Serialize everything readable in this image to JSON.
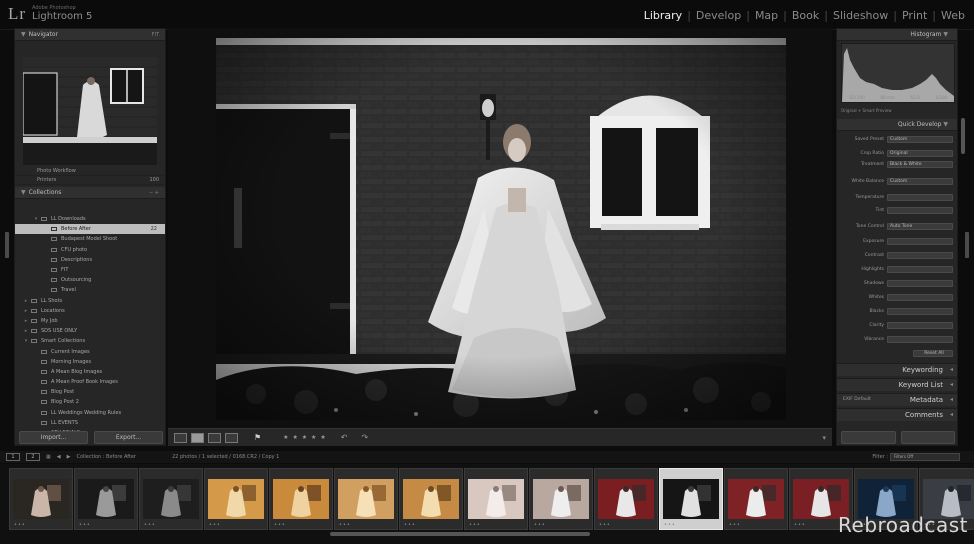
{
  "app": {
    "logo": "Lr",
    "brand_sub": "Adobe Photoshop",
    "brand_name": "Lightroom 5"
  },
  "modules": [
    "Library",
    "Develop",
    "Map",
    "Book",
    "Slideshow",
    "Print",
    "Web"
  ],
  "active_module": "Library",
  "left_panel": {
    "navigator_title": "Navigator",
    "navigator_zoom": "FIT",
    "folders": [
      {
        "name": "Photo Workflow",
        "count": ""
      },
      {
        "name": "Printers",
        "count": "100"
      }
    ],
    "collections_title": "Collections",
    "collections": [
      {
        "name": "LL Downloads",
        "count": "",
        "selected": false
      },
      {
        "name": "Before After",
        "count": "22",
        "selected": true
      },
      {
        "name": "Budapest Model Shoot",
        "count": "",
        "selected": false
      },
      {
        "name": "CFU photo",
        "count": "",
        "selected": false
      },
      {
        "name": "Descriptions",
        "count": "",
        "selected": false
      },
      {
        "name": "FIT",
        "count": "",
        "selected": false
      },
      {
        "name": "Outsourcing",
        "count": "",
        "selected": false
      },
      {
        "name": "Travel",
        "count": "",
        "selected": false
      },
      {
        "name": "LL Shots",
        "count": "",
        "selected": false
      },
      {
        "name": "Locations",
        "count": "",
        "selected": false
      },
      {
        "name": "My Job",
        "count": "",
        "selected": false
      },
      {
        "name": "SDS USE ONLY",
        "count": "",
        "selected": false
      },
      {
        "name": "Smart Collections",
        "count": "",
        "selected": false
      },
      {
        "name": "Current Images",
        "count": "",
        "selected": false
      },
      {
        "name": "Morning Images",
        "count": "",
        "selected": false
      },
      {
        "name": "A Mean Blog Images",
        "count": "",
        "selected": false
      },
      {
        "name": "A Mean Proof Book Images",
        "count": "",
        "selected": false
      },
      {
        "name": "Blog Post",
        "count": "",
        "selected": false
      },
      {
        "name": "Blog Post 2",
        "count": "",
        "selected": false
      },
      {
        "name": "LL Weddings Wedding Rules",
        "count": "",
        "selected": false
      },
      {
        "name": "LL EVENTS",
        "count": "",
        "selected": false
      },
      {
        "name": "CFU FINALS",
        "count": "",
        "selected": false
      }
    ],
    "import_label": "Import...",
    "export_label": "Export..."
  },
  "right_panel": {
    "histogram_title": "Histogram",
    "histogram_info": [
      "ISO 200",
      "80 mm",
      "f/2.8",
      "1/200"
    ],
    "original_photo_label": "Original + Smart Preview",
    "quick_develop_title": "Quick Develop",
    "saved_preset_label": "Saved Preset",
    "saved_preset_value": "Custom",
    "crop_ratio_label": "Crop Ratio",
    "crop_ratio_value": "Original",
    "treatment_label": "Treatment",
    "treatment_value": "Black & White",
    "white_balance_label": "White Balance",
    "white_balance_value": "Custom",
    "temperature_label": "Temperature",
    "tint_label": "Tint",
    "tone_control_label": "Tone Control",
    "tone_control_value": "Auto Tone",
    "tone_rows": [
      "Exposure",
      "Contrast",
      "Highlights",
      "Shadows",
      "Whites",
      "Blacks",
      "Clarity",
      "Vibrance"
    ],
    "reset_label": "Reset All",
    "sections": [
      "Keywording",
      "Keyword List",
      "Metadata",
      "Comments"
    ],
    "metadata_preset": "EXIF Default"
  },
  "toolbar": {
    "stars": "★ ★ ★ ★ ★"
  },
  "filmstrip_bar": {
    "page1": "1",
    "page2": "2",
    "breadcrumb": "Collection : Before After",
    "selection": "22 photos / 1 selected / 0168.CR2 / Copy 1",
    "filter_label": "Filter :",
    "filter_value": "Filters Off"
  },
  "watermark": "Rebroadcast",
  "colors": {
    "accent_selected": "#cfcfcf",
    "panel_bg": "#262626",
    "app_bg": "#0c0c0c"
  }
}
